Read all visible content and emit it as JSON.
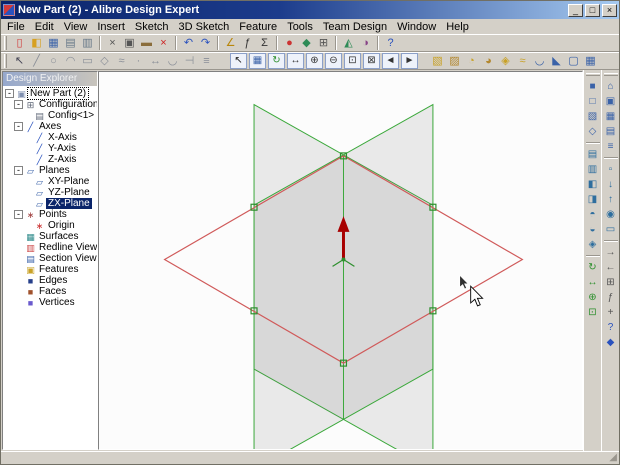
{
  "window": {
    "title": "New Part (2) - Alibre Design Expert",
    "controls": {
      "minimize": "_",
      "maximize": "□",
      "close": "×"
    }
  },
  "menu": {
    "items": [
      "File",
      "Edit",
      "View",
      "Insert",
      "Sketch",
      "3D Sketch",
      "Feature",
      "Tools",
      "Team Design",
      "Window",
      "Help"
    ]
  },
  "toolbars": {
    "standard": [
      {
        "n": "new-document",
        "g": "▯",
        "c": "#d23a3a"
      },
      {
        "n": "open-file",
        "g": "◧",
        "c": "#d7a022"
      },
      {
        "n": "save",
        "g": "▦",
        "c": "#3a62a8"
      },
      {
        "n": "print",
        "g": "▤",
        "c": "#667788"
      },
      {
        "n": "print-preview",
        "g": "▥",
        "c": "#667788"
      },
      "|",
      {
        "n": "cut",
        "g": "×",
        "c": "#555555"
      },
      {
        "n": "copy",
        "g": "▣",
        "c": "#555555"
      },
      {
        "n": "paste",
        "g": "▬",
        "c": "#8a6d3b"
      },
      {
        "n": "delete",
        "g": "×",
        "c": "#cc2222"
      },
      "|",
      {
        "n": "undo",
        "g": "↶",
        "c": "#2a52be"
      },
      {
        "n": "redo",
        "g": "↷",
        "c": "#2a52be"
      },
      "|",
      {
        "n": "measure",
        "g": "∠",
        "c": "#b8860b"
      },
      {
        "n": "equation-editor",
        "g": "ƒ",
        "c": "#333333"
      },
      {
        "n": "parameters",
        "g": "Σ",
        "c": "#333333"
      },
      "|",
      {
        "n": "color-properties",
        "g": "●",
        "c": "#cc3333"
      },
      {
        "n": "physical-properties",
        "g": "◆",
        "c": "#2e8b57"
      },
      {
        "n": "mass-properties",
        "g": "⊞",
        "c": "#555555"
      },
      "|",
      {
        "n": "analysis",
        "g": "◭",
        "c": "#2e8b57"
      },
      {
        "n": "render",
        "g": "◑",
        "c": "#884488"
      },
      "|",
      {
        "n": "help",
        "g": "?",
        "c": "#2a52be"
      }
    ],
    "sketch": [
      {
        "n": "select",
        "g": "↖",
        "c": "#444455"
      },
      {
        "n": "line-tool",
        "g": "╱",
        "c": "#8a8f98"
      },
      {
        "n": "circle-tool",
        "g": "○",
        "c": "#8a8f98"
      },
      {
        "n": "arc-tool",
        "g": "◠",
        "c": "#8a8f98"
      },
      {
        "n": "rectangle-tool",
        "g": "▭",
        "c": "#8a8f98"
      },
      {
        "n": "polygon-tool",
        "g": "◇",
        "c": "#8a8f98"
      },
      {
        "n": "spline-tool",
        "g": "≈",
        "c": "#8a8f98"
      },
      {
        "n": "point-tool",
        "g": "·",
        "c": "#8a8f98"
      },
      {
        "n": "dimension-tool",
        "g": "↔",
        "c": "#8a8f98"
      },
      {
        "n": "fillet-tool",
        "g": "◡",
        "c": "#8a8f98"
      },
      {
        "n": "trim-tool",
        "g": "⊣",
        "c": "#8a8f98"
      },
      {
        "n": "constraints-tool",
        "g": "≡",
        "c": "#8a8f98"
      }
    ],
    "view": [
      {
        "n": "select-arrow",
        "g": "↖",
        "c": "#222222",
        "boxed": true
      },
      {
        "n": "select-face",
        "g": "▦",
        "c": "#3a62a8",
        "boxed": true
      },
      {
        "n": "orbit",
        "g": "↻",
        "c": "#2d8f2d",
        "boxed": true
      },
      {
        "n": "pan",
        "g": "↔",
        "c": "#333333",
        "boxed": true
      },
      {
        "n": "zoom-in",
        "g": "⊕",
        "c": "#333333",
        "boxed": true
      },
      {
        "n": "zoom-out",
        "g": "⊖",
        "c": "#333333",
        "boxed": true
      },
      {
        "n": "zoom-window",
        "g": "⊡",
        "c": "#333333",
        "boxed": true
      },
      {
        "n": "zoom-fit",
        "g": "⊠",
        "c": "#333333",
        "boxed": true
      },
      {
        "n": "previous-view",
        "g": "◄",
        "c": "#333333",
        "boxed": true
      },
      {
        "n": "next-view",
        "g": "►",
        "c": "#333333",
        "boxed": true
      }
    ],
    "feature": [
      {
        "n": "extrude-boss",
        "g": "▧",
        "c": "#c9a227"
      },
      {
        "n": "extrude-cut",
        "g": "▨",
        "c": "#b3882f"
      },
      {
        "n": "revolve-boss",
        "g": "◔",
        "c": "#c9a227"
      },
      {
        "n": "revolve-cut",
        "g": "◕",
        "c": "#b3882f"
      },
      {
        "n": "loft",
        "g": "◈",
        "c": "#c9a227"
      },
      {
        "n": "sweep",
        "g": "≈",
        "c": "#c9a227"
      },
      {
        "n": "fillet-feature",
        "g": "◡",
        "c": "#3a62a8"
      },
      {
        "n": "chamfer",
        "g": "◣",
        "c": "#3a62a8"
      },
      {
        "n": "shell",
        "g": "▢",
        "c": "#3a62a8"
      },
      {
        "n": "pattern",
        "g": "▦",
        "c": "#3a62a8"
      }
    ],
    "right_inner": [
      {
        "n": "display-shaded",
        "g": "■",
        "c": "#3a62a8"
      },
      {
        "n": "display-wireframe",
        "g": "□",
        "c": "#3a62a8"
      },
      {
        "n": "display-hidden-line",
        "g": "▧",
        "c": "#3a62a8"
      },
      {
        "n": "display-perspective",
        "g": "◇",
        "c": "#3a62a8"
      },
      "-",
      {
        "n": "view-front",
        "g": "▤",
        "c": "#2e6e9e"
      },
      {
        "n": "view-back",
        "g": "▥",
        "c": "#2e6e9e"
      },
      {
        "n": "view-left",
        "g": "◧",
        "c": "#2e6e9e"
      },
      {
        "n": "view-right",
        "g": "◨",
        "c": "#2e6e9e"
      },
      {
        "n": "view-top",
        "g": "◓",
        "c": "#2e6e9e"
      },
      {
        "n": "view-bottom",
        "g": "◒",
        "c": "#2e6e9e"
      },
      {
        "n": "view-isometric",
        "g": "◈",
        "c": "#2e6e9e"
      },
      "-",
      {
        "n": "orbit-view",
        "g": "↻",
        "c": "#2d8f2d"
      },
      {
        "n": "pan-view",
        "g": "↔",
        "c": "#2d8f2d"
      },
      {
        "n": "zoom-view",
        "g": "⊕",
        "c": "#2d8f2d"
      },
      {
        "n": "fit-view",
        "g": "⊡",
        "c": "#2d8f2d"
      }
    ],
    "right_outer": [
      {
        "n": "home-window",
        "g": "⌂",
        "c": "#3a62a8"
      },
      {
        "n": "new-part-workspace",
        "g": "▣",
        "c": "#3a62a8"
      },
      {
        "n": "new-assembly-workspace",
        "g": "▦",
        "c": "#3a62a8"
      },
      {
        "n": "new-drawing-workspace",
        "g": "▤",
        "c": "#3a62a8"
      },
      {
        "n": "bill-of-materials",
        "g": "≡",
        "c": "#3a62a8"
      },
      "-",
      {
        "n": "repository",
        "g": "▫",
        "c": "#2e6e9e"
      },
      {
        "n": "check-in",
        "g": "↓",
        "c": "#2e6e9e"
      },
      {
        "n": "check-out",
        "g": "↑",
        "c": "#2e6e9e"
      },
      {
        "n": "team-design-session",
        "g": "◉",
        "c": "#2e6e9e"
      },
      {
        "n": "message-center",
        "g": "▭",
        "c": "#2e6e9e"
      },
      "-",
      {
        "n": "export",
        "g": "→",
        "c": "#555555"
      },
      {
        "n": "import",
        "g": "←",
        "c": "#555555"
      },
      {
        "n": "options",
        "g": "⊞",
        "c": "#555555"
      },
      {
        "n": "macros",
        "g": "ƒ",
        "c": "#555555"
      },
      {
        "n": "add-ons",
        "g": "+",
        "c": "#555555"
      },
      {
        "n": "help-topics",
        "g": "?",
        "c": "#2a52be"
      },
      {
        "n": "about",
        "g": "◆",
        "c": "#2a52be"
      }
    ]
  },
  "explorer": {
    "title": "Design Explorer",
    "tree": [
      {
        "label": "New Part (2)",
        "depth": 0,
        "expand": true,
        "focused": true,
        "icon": "part-icon",
        "glyph": "▣",
        "color": "#8090b0"
      },
      {
        "label": "Configurations",
        "depth": 1,
        "expand": true,
        "icon": "configurations-icon",
        "glyph": "⊞",
        "color": "#606878"
      },
      {
        "label": "Config<1>",
        "depth": 2,
        "icon": "config-icon",
        "glyph": "▤",
        "color": "#606878"
      },
      {
        "label": "Axes",
        "depth": 1,
        "expand": true,
        "icon": "axes-icon",
        "glyph": "╱",
        "color": "#2a52be"
      },
      {
        "label": "X-Axis",
        "depth": 2,
        "icon": "axis-icon",
        "glyph": "╱",
        "color": "#2a52be"
      },
      {
        "label": "Y-Axis",
        "depth": 2,
        "icon": "axis-icon",
        "glyph": "╱",
        "color": "#2a52be"
      },
      {
        "label": "Z-Axis",
        "depth": 2,
        "icon": "axis-icon",
        "glyph": "╱",
        "color": "#2a52be"
      },
      {
        "label": "Planes",
        "depth": 1,
        "expand": true,
        "icon": "planes-icon",
        "glyph": "▱",
        "color": "#3a62a8"
      },
      {
        "label": "XY-Plane",
        "depth": 2,
        "icon": "plane-icon",
        "glyph": "▱",
        "color": "#3a62a8"
      },
      {
        "label": "YZ-Plane",
        "depth": 2,
        "icon": "plane-icon",
        "glyph": "▱",
        "color": "#3a62a8"
      },
      {
        "label": "ZX-Plane",
        "depth": 2,
        "selected": true,
        "icon": "plane-icon",
        "glyph": "▱",
        "color": "#3a62a8"
      },
      {
        "label": "Points",
        "depth": 1,
        "expand": true,
        "icon": "points-icon",
        "glyph": "∗",
        "color": "#a04040"
      },
      {
        "label": "Origin",
        "depth": 2,
        "icon": "origin-icon",
        "glyph": "∗",
        "color": "#cc3333"
      },
      {
        "label": "Surfaces",
        "depth": 1,
        "icon": "surfaces-icon",
        "glyph": "▦",
        "color": "#2e8b8b"
      },
      {
        "label": "Redline Views",
        "depth": 1,
        "icon": "redline-views-icon",
        "glyph": "▥",
        "color": "#cc4444"
      },
      {
        "label": "Section Views",
        "depth": 1,
        "icon": "section-views-icon",
        "glyph": "▤",
        "color": "#3a62a8"
      },
      {
        "label": "Features",
        "depth": 1,
        "icon": "features-icon",
        "glyph": "▣",
        "color": "#c9a227"
      },
      {
        "label": "Edges",
        "depth": 1,
        "icon": "edges-icon",
        "glyph": "■",
        "color": "#27408b"
      },
      {
        "label": "Faces",
        "depth": 1,
        "icon": "faces-icon",
        "glyph": "■",
        "color": "#a0522d"
      },
      {
        "label": "Vertices",
        "depth": 1,
        "icon": "vertices-icon",
        "glyph": "■",
        "color": "#6a5acd"
      }
    ]
  },
  "canvas": {
    "colors": {
      "background": "#fcfcfc",
      "plane_edge_green": "#3aa83a",
      "plane_edge_red": "#d05a5a",
      "plane_fill": "rgba(110,110,110,0.13)",
      "axis_arrow": "#a80000",
      "triad_green": "#2d8f2d"
    }
  },
  "statusbar": {
    "text": ""
  }
}
